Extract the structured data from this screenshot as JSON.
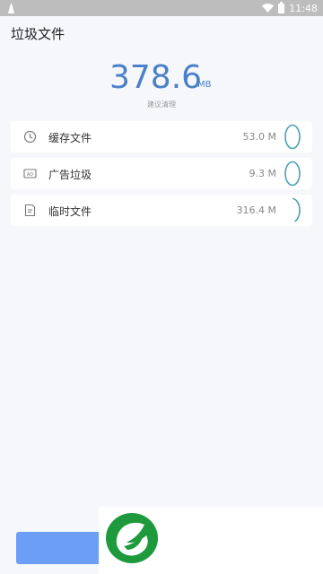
{
  "status_bar": {
    "time": "11:48",
    "icons": [
      "notification-icon",
      "wifi-icon",
      "battery-icon"
    ]
  },
  "header": {
    "title": "垃圾文件"
  },
  "summary": {
    "total_size": "378.6",
    "unit": "MB",
    "hint": "建议清理"
  },
  "items": [
    {
      "label": "缓存文件",
      "size": "53.0 M",
      "icon": "clock-icon",
      "progress": 1.0
    },
    {
      "label": "广告垃圾",
      "size": "9.3 M",
      "icon": "ad-icon",
      "progress": 1.0
    },
    {
      "label": "临时文件",
      "size": "316.4 M",
      "icon": "temp-file-icon",
      "progress": 0.45
    }
  ],
  "footer": {
    "button_label": ""
  },
  "colors": {
    "accent": "#4a80c9",
    "button": "#6b9ef5",
    "background": "#f5f7fb",
    "status_bar": "#bdbdbd",
    "logo_green": "#1e9a3c"
  }
}
